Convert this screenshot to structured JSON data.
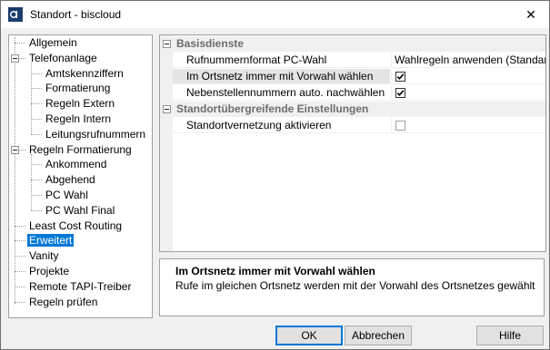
{
  "window": {
    "title": "Standort - biscloud",
    "close_glyph": "✕"
  },
  "tree": {
    "items": [
      {
        "label": "Allgemein",
        "level": 0
      },
      {
        "label": "Telefonanlage",
        "level": 0,
        "expanded": true
      },
      {
        "label": "Amtskennziffern",
        "level": 1
      },
      {
        "label": "Formatierung",
        "level": 1
      },
      {
        "label": "Regeln Extern",
        "level": 1
      },
      {
        "label": "Regeln Intern",
        "level": 1
      },
      {
        "label": "Leitungsrufnummern",
        "level": 1
      },
      {
        "label": "Regeln Formatierung",
        "level": 0,
        "expanded": true
      },
      {
        "label": "Ankommend",
        "level": 1
      },
      {
        "label": "Abgehend",
        "level": 1
      },
      {
        "label": "PC Wahl",
        "level": 1
      },
      {
        "label": "PC Wahl Final",
        "level": 1
      },
      {
        "label": "Least Cost Routing",
        "level": 0
      },
      {
        "label": "Erweitert",
        "level": 0,
        "selected": true
      },
      {
        "label": "Vanity",
        "level": 0
      },
      {
        "label": "Projekte",
        "level": 0
      },
      {
        "label": "Remote TAPI-Treiber",
        "level": 0
      },
      {
        "label": "Regeln prüfen",
        "level": 0
      }
    ]
  },
  "grid": {
    "sections": [
      {
        "title": "Basisdienste",
        "rows": [
          {
            "name": "Rufnummernformat PC-Wahl",
            "value": "Wahlregeln anwenden (Standar",
            "type": "text"
          },
          {
            "name": "Im Ortsnetz immer mit Vorwahl wählen",
            "checked": true,
            "type": "check",
            "highlight": true
          },
          {
            "name": "Nebenstellennummern auto. nachwählen",
            "checked": true,
            "type": "check"
          }
        ]
      },
      {
        "title": "Standortübergreifende Einstellungen",
        "rows": [
          {
            "name": "Standortvernetzung aktivieren",
            "checked": false,
            "type": "check"
          }
        ]
      }
    ]
  },
  "description": {
    "title": "Im Ortsnetz immer mit Vorwahl wählen",
    "text": "Rufe im gleichen Ortsnetz werden mit der Vorwahl des Ortsnetzes gewählt"
  },
  "buttons": {
    "ok": "OK",
    "cancel": "Abbrechen",
    "help": "Hilfe"
  },
  "colors": {
    "selection": "#0078d7",
    "section_text": "#6d6d6d",
    "gutter": "#f0f0f0"
  }
}
